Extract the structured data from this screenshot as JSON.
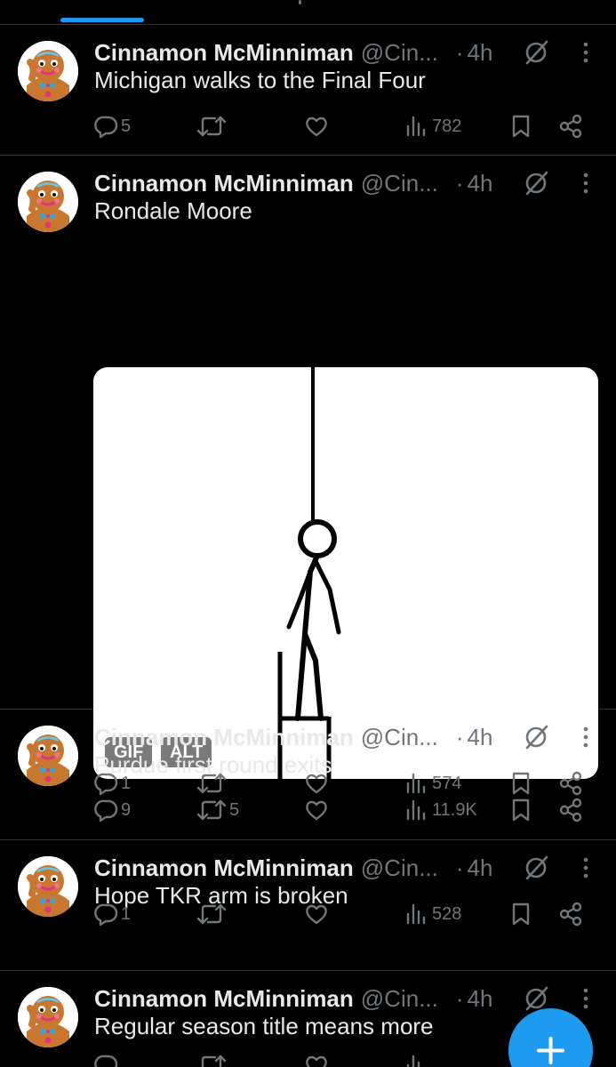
{
  "colors": {
    "background": "#000000",
    "accent": "#1d9bf0",
    "text": "#e7e9ea",
    "muted": "#71767b",
    "divider": "#2f3336"
  },
  "tweets": [
    {
      "name": "Cinnamon McMinniman",
      "handle": "@Cin...",
      "time": "4h",
      "text": "Michigan walks to the Final Four",
      "replies": "5",
      "retweets": "",
      "views": "782"
    },
    {
      "name": "Cinnamon McMinniman",
      "handle": "@Cin...",
      "time": "4h",
      "text": "Rondale Moore",
      "replies": "9",
      "retweets": "5",
      "views": "11.9K",
      "media": {
        "gif_badge": "GIF",
        "alt_badge": "ALT"
      }
    },
    {
      "name": "Cinnamon McMinniman",
      "handle": "@Cin...",
      "time": "4h",
      "text": "Purdue first round exits",
      "replies": "1",
      "retweets": "",
      "views": "574"
    },
    {
      "name": "Cinnamon McMinniman",
      "handle": "@Cin...",
      "time": "4h",
      "text": "Hope TKR arm is broken",
      "replies": "1",
      "retweets": "",
      "views": "528"
    },
    {
      "name": "Cinnamon McMinniman",
      "handle": "@Cin...",
      "time": "4h",
      "text": "Regular season title means more",
      "replies": "",
      "retweets": "",
      "views": ""
    }
  ],
  "icons": [
    "reply-icon",
    "retweet-icon",
    "like-icon",
    "views-icon",
    "bookmark-icon",
    "share-icon",
    "grok-icon",
    "more-icon",
    "compose-plus-icon"
  ]
}
